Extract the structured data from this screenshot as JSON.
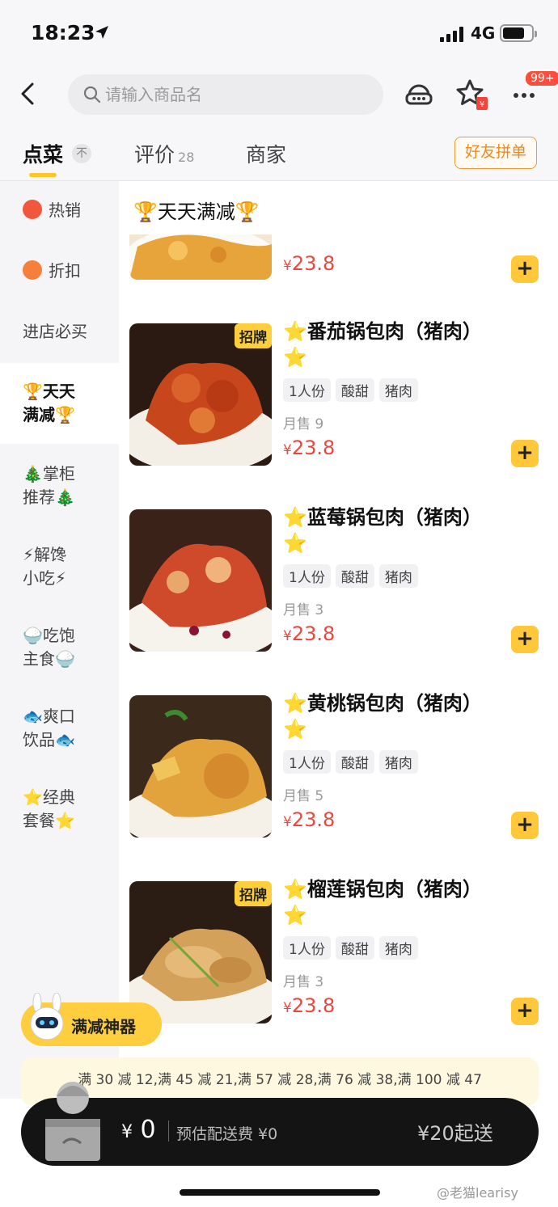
{
  "status_bar": {
    "time": "18:23",
    "network": "4G"
  },
  "header": {
    "search_placeholder": "请输入商品名",
    "badge": "99+"
  },
  "tabs": [
    {
      "label": "点菜",
      "active": true
    },
    {
      "label": "评价",
      "count": "28"
    },
    {
      "label": "商家"
    }
  ],
  "tabs_sort_icon": "不",
  "group_order_label": "好友拼单",
  "sidebar": {
    "items": [
      {
        "label": "热销"
      },
      {
        "label": "折扣"
      },
      {
        "label": "进店必买"
      },
      {
        "line1": "🏆天天",
        "line2": "满减🏆",
        "active": true
      },
      {
        "line1": "🎄掌柜",
        "line2": "推荐🎄"
      },
      {
        "line1": "⚡解馋",
        "line2": "小吃⚡"
      },
      {
        "line1": "🍚吃饱",
        "line2": "主食🍚"
      },
      {
        "line1": "🐟爽口",
        "line2": "饮品🐟"
      },
      {
        "line1": "⭐经典",
        "line2": "套餐⭐"
      }
    ]
  },
  "section_title": "🏆天天满减🏆",
  "partial_item": {
    "price": "23.8"
  },
  "items": [
    {
      "name": "番茄锅包肉（猪肉）",
      "badge": "招牌",
      "tags": [
        "1人份",
        "酸甜",
        "猪肉"
      ],
      "sold": "月售 9",
      "price": "23.8"
    },
    {
      "name": "蓝莓锅包肉（猪肉）",
      "badge": "",
      "tags": [
        "1人份",
        "酸甜",
        "猪肉"
      ],
      "sold": "月售 3",
      "price": "23.8"
    },
    {
      "name": "黄桃锅包肉（猪肉）",
      "badge": "",
      "tags": [
        "1人份",
        "酸甜",
        "猪肉"
      ],
      "sold": "月售 5",
      "price": "23.8"
    },
    {
      "name": "榴莲锅包肉（猪肉）",
      "badge": "招牌",
      "tags": [
        "1人份",
        "酸甜",
        "猪肉"
      ],
      "sold": "月售 3",
      "price": "23.8"
    }
  ],
  "currency": "¥",
  "promo": {
    "button_label": "满减神器",
    "rules": "满 30 减 12,满 45 减 21,满 57 减 28,满 76 减 38,满 100 减 47"
  },
  "cart": {
    "total": "0",
    "delivery": "预估配送费 ¥0",
    "min_order": "¥20起送"
  },
  "watermark": "@老猫learisy",
  "colors": {
    "accent": "#ffc83a",
    "price": "#f0453c",
    "cart_bg": "#141414"
  }
}
